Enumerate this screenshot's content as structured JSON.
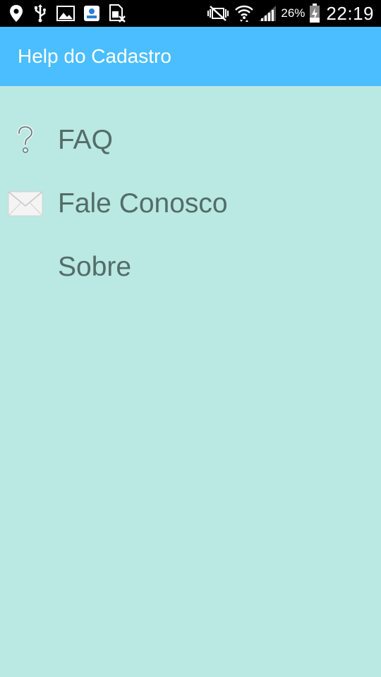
{
  "status_bar": {
    "icons": [
      "location-icon",
      "usb-icon",
      "image-icon",
      "app-notification-icon",
      "no-sim-icon",
      "mute-icon",
      "wifi-icon",
      "signal-icon",
      "battery-icon"
    ],
    "battery": "26%",
    "time": "22:19"
  },
  "app_bar": {
    "title": "Help do Cadastro",
    "color": "#4bbeff"
  },
  "menu": {
    "items": [
      {
        "label": "FAQ",
        "icon": "question-icon"
      },
      {
        "label": "Fale Conosco",
        "icon": "envelope-icon"
      },
      {
        "label": "Sobre",
        "icon": ""
      }
    ]
  },
  "colors": {
    "background": "#bae8e2",
    "label_text": "#536c6a"
  }
}
